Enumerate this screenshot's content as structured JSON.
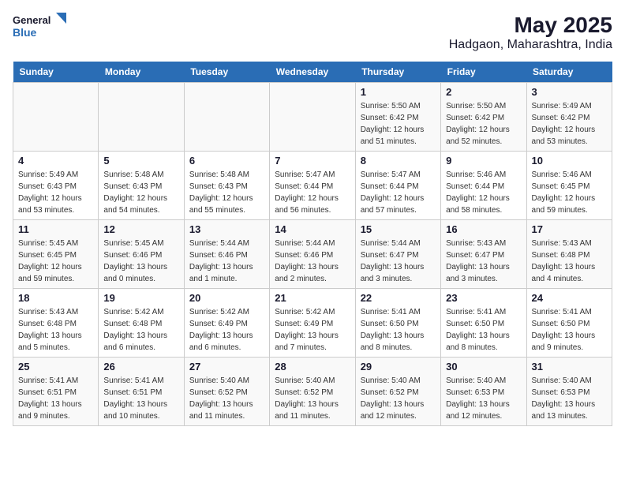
{
  "header": {
    "logo_line1": "General",
    "logo_line2": "Blue",
    "title": "May 2025",
    "subtitle": "Hadgaon, Maharashtra, India"
  },
  "days_of_week": [
    "Sunday",
    "Monday",
    "Tuesday",
    "Wednesday",
    "Thursday",
    "Friday",
    "Saturday"
  ],
  "weeks": [
    [
      {
        "num": "",
        "info": ""
      },
      {
        "num": "",
        "info": ""
      },
      {
        "num": "",
        "info": ""
      },
      {
        "num": "",
        "info": ""
      },
      {
        "num": "1",
        "info": "Sunrise: 5:50 AM\nSunset: 6:42 PM\nDaylight: 12 hours and 51 minutes."
      },
      {
        "num": "2",
        "info": "Sunrise: 5:50 AM\nSunset: 6:42 PM\nDaylight: 12 hours and 52 minutes."
      },
      {
        "num": "3",
        "info": "Sunrise: 5:49 AM\nSunset: 6:42 PM\nDaylight: 12 hours and 53 minutes."
      }
    ],
    [
      {
        "num": "4",
        "info": "Sunrise: 5:49 AM\nSunset: 6:43 PM\nDaylight: 12 hours and 53 minutes."
      },
      {
        "num": "5",
        "info": "Sunrise: 5:48 AM\nSunset: 6:43 PM\nDaylight: 12 hours and 54 minutes."
      },
      {
        "num": "6",
        "info": "Sunrise: 5:48 AM\nSunset: 6:43 PM\nDaylight: 12 hours and 55 minutes."
      },
      {
        "num": "7",
        "info": "Sunrise: 5:47 AM\nSunset: 6:44 PM\nDaylight: 12 hours and 56 minutes."
      },
      {
        "num": "8",
        "info": "Sunrise: 5:47 AM\nSunset: 6:44 PM\nDaylight: 12 hours and 57 minutes."
      },
      {
        "num": "9",
        "info": "Sunrise: 5:46 AM\nSunset: 6:44 PM\nDaylight: 12 hours and 58 minutes."
      },
      {
        "num": "10",
        "info": "Sunrise: 5:46 AM\nSunset: 6:45 PM\nDaylight: 12 hours and 59 minutes."
      }
    ],
    [
      {
        "num": "11",
        "info": "Sunrise: 5:45 AM\nSunset: 6:45 PM\nDaylight: 12 hours and 59 minutes."
      },
      {
        "num": "12",
        "info": "Sunrise: 5:45 AM\nSunset: 6:46 PM\nDaylight: 13 hours and 0 minutes."
      },
      {
        "num": "13",
        "info": "Sunrise: 5:44 AM\nSunset: 6:46 PM\nDaylight: 13 hours and 1 minute."
      },
      {
        "num": "14",
        "info": "Sunrise: 5:44 AM\nSunset: 6:46 PM\nDaylight: 13 hours and 2 minutes."
      },
      {
        "num": "15",
        "info": "Sunrise: 5:44 AM\nSunset: 6:47 PM\nDaylight: 13 hours and 3 minutes."
      },
      {
        "num": "16",
        "info": "Sunrise: 5:43 AM\nSunset: 6:47 PM\nDaylight: 13 hours and 3 minutes."
      },
      {
        "num": "17",
        "info": "Sunrise: 5:43 AM\nSunset: 6:48 PM\nDaylight: 13 hours and 4 minutes."
      }
    ],
    [
      {
        "num": "18",
        "info": "Sunrise: 5:43 AM\nSunset: 6:48 PM\nDaylight: 13 hours and 5 minutes."
      },
      {
        "num": "19",
        "info": "Sunrise: 5:42 AM\nSunset: 6:48 PM\nDaylight: 13 hours and 6 minutes."
      },
      {
        "num": "20",
        "info": "Sunrise: 5:42 AM\nSunset: 6:49 PM\nDaylight: 13 hours and 6 minutes."
      },
      {
        "num": "21",
        "info": "Sunrise: 5:42 AM\nSunset: 6:49 PM\nDaylight: 13 hours and 7 minutes."
      },
      {
        "num": "22",
        "info": "Sunrise: 5:41 AM\nSunset: 6:50 PM\nDaylight: 13 hours and 8 minutes."
      },
      {
        "num": "23",
        "info": "Sunrise: 5:41 AM\nSunset: 6:50 PM\nDaylight: 13 hours and 8 minutes."
      },
      {
        "num": "24",
        "info": "Sunrise: 5:41 AM\nSunset: 6:50 PM\nDaylight: 13 hours and 9 minutes."
      }
    ],
    [
      {
        "num": "25",
        "info": "Sunrise: 5:41 AM\nSunset: 6:51 PM\nDaylight: 13 hours and 9 minutes."
      },
      {
        "num": "26",
        "info": "Sunrise: 5:41 AM\nSunset: 6:51 PM\nDaylight: 13 hours and 10 minutes."
      },
      {
        "num": "27",
        "info": "Sunrise: 5:40 AM\nSunset: 6:52 PM\nDaylight: 13 hours and 11 minutes."
      },
      {
        "num": "28",
        "info": "Sunrise: 5:40 AM\nSunset: 6:52 PM\nDaylight: 13 hours and 11 minutes."
      },
      {
        "num": "29",
        "info": "Sunrise: 5:40 AM\nSunset: 6:52 PM\nDaylight: 13 hours and 12 minutes."
      },
      {
        "num": "30",
        "info": "Sunrise: 5:40 AM\nSunset: 6:53 PM\nDaylight: 13 hours and 12 minutes."
      },
      {
        "num": "31",
        "info": "Sunrise: 5:40 AM\nSunset: 6:53 PM\nDaylight: 13 hours and 13 minutes."
      }
    ]
  ]
}
